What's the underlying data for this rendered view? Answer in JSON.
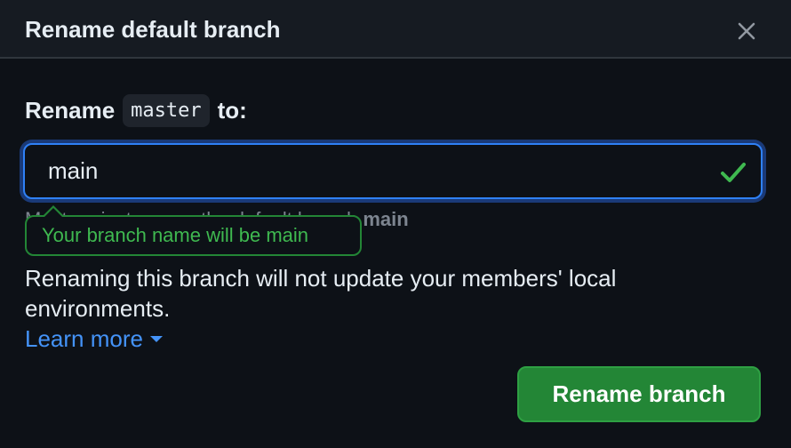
{
  "dialog": {
    "title": "Rename default branch",
    "close_icon": "close-icon"
  },
  "form": {
    "label_prefix": "Rename",
    "current_branch": "master",
    "label_suffix": "to:",
    "input_value": "main",
    "valid_icon": "check-icon",
    "hint_prefix": "Most projects name the default branch",
    "hint_branch": "main",
    "tooltip": "Your branch name will be main"
  },
  "info": {
    "text": "Renaming this branch will not update your members' local environments.",
    "learn_more": "Learn more",
    "learn_more_icon": "caret-down-icon"
  },
  "actions": {
    "rename_button": "Rename branch"
  },
  "colors": {
    "background": "#0d1117",
    "accent_blue": "#2f81f7",
    "success_green": "#3fb950",
    "button_green": "#238636",
    "link_blue": "#4493f8"
  }
}
